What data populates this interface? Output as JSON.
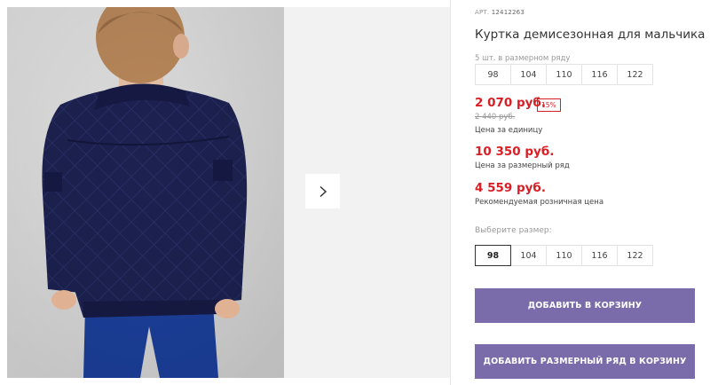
{
  "product": {
    "article_label": "АРТ.",
    "article_number": "12412263",
    "title": "Куртка демисезонная для мальчика",
    "pack_note": "5 шт. в размерном ряду",
    "pack_sizes": [
      "98",
      "104",
      "110",
      "116",
      "122"
    ],
    "price": "2 070 руб.",
    "discount": "15%",
    "old_price": "2 440 руб.",
    "price_caption": "Цена за единицу",
    "row_price": "10 350 руб.",
    "row_price_caption": "Цена за размерный ряд",
    "retail_price": "4 559 руб.",
    "retail_price_caption": "Рекомендуемая розничная цена",
    "choose_size_label": "Выберите размер:",
    "select_sizes": [
      "98",
      "104",
      "110",
      "116",
      "122"
    ],
    "selected_size": "98",
    "add_to_cart": "ДОБАВИТЬ В КОРЗИНУ",
    "add_row_to_cart": "ДОБАВИТЬ РАЗМЕРНЫЙ РЯД В КОРЗИНУ"
  },
  "gallery": {
    "next_icon": "chevron-right-icon"
  },
  "colors": {
    "price_red": "#d81f26",
    "button_purple": "#7a6bab",
    "jacket_navy": "#1c2150"
  }
}
